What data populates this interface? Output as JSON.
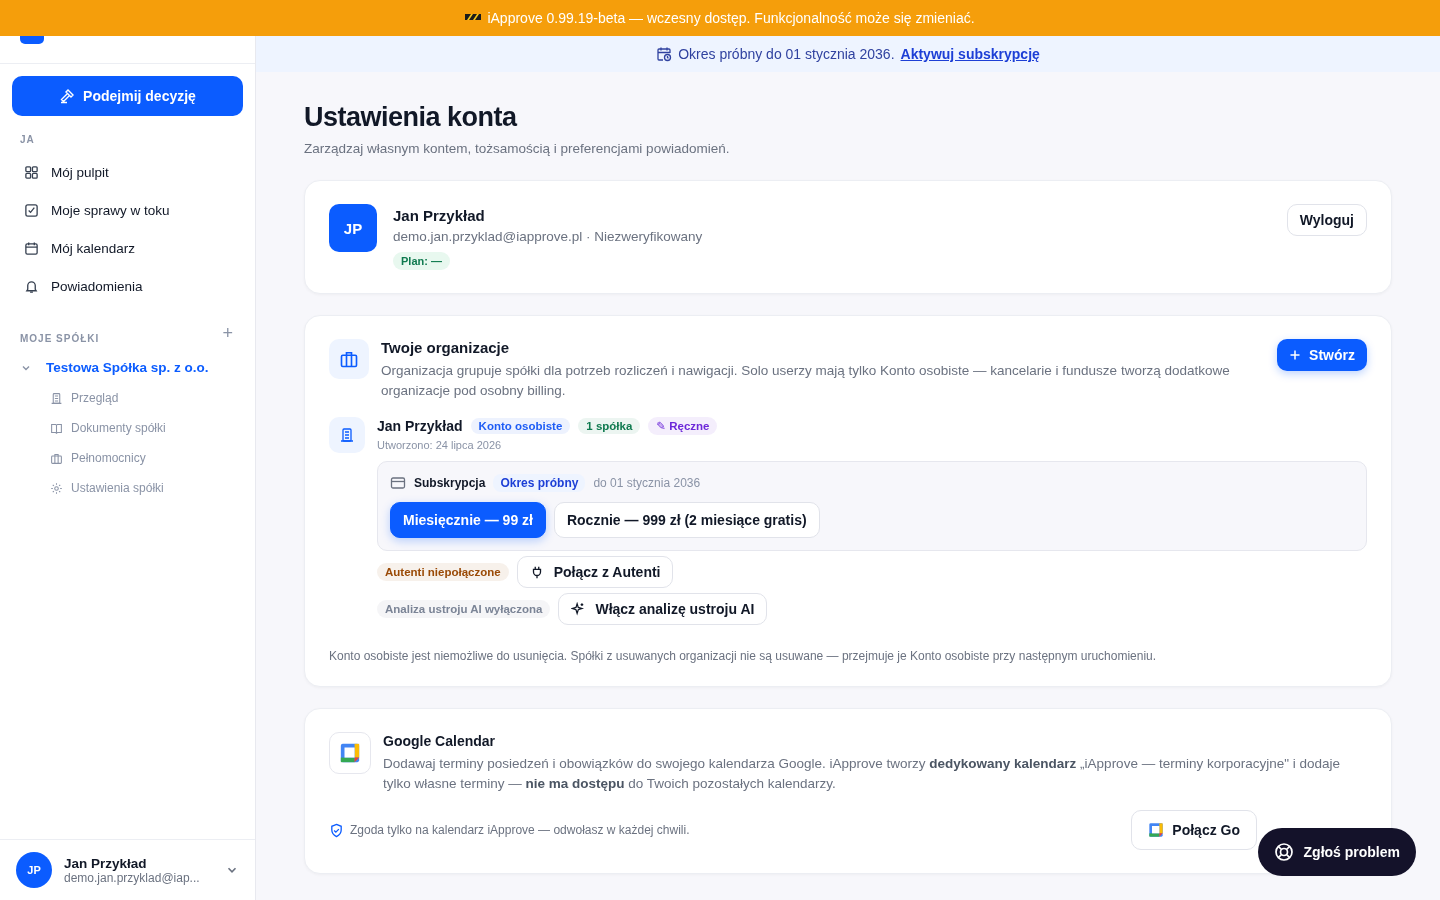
{
  "banner": {
    "text": "iApprove 0.99.19-beta — wczesny dostęp. Funkcjonalność może się zmieniać."
  },
  "sidebar": {
    "primary_button": "Podejmij decyzję",
    "section_me": "JA",
    "items": [
      {
        "label": "Mój pulpit"
      },
      {
        "label": "Moje sprawy w toku"
      },
      {
        "label": "Mój kalendarz"
      },
      {
        "label": "Powiadomienia"
      }
    ],
    "section_companies": "MOJE SPÓŁKI",
    "add_symbol": "+",
    "companies": [
      {
        "name": "Testowa Spółka sp. z o.o.",
        "expanded": true,
        "children": [
          {
            "label": "Przegląd"
          },
          {
            "label": "Dokumenty spółki"
          },
          {
            "label": "Pełnomocnicy"
          },
          {
            "label": "Ustawienia spółki"
          }
        ]
      }
    ],
    "user": {
      "initials": "JP",
      "name": "Jan Przykład",
      "email": "demo.jan.przyklad@iap..."
    }
  },
  "trial_bar": {
    "text": "Okres próbny do 01 stycznia 2036.",
    "link": "Aktywuj subskrypcję"
  },
  "page": {
    "title": "Ustawienia konta",
    "subtitle": "Zarządzaj własnym kontem, tożsamością i preferencjami powiadomień."
  },
  "profile": {
    "initials": "JP",
    "name": "Jan Przykład",
    "details": "demo.jan.przyklad@iapprove.pl · Niezweryfikowany",
    "plan": "Plan: —",
    "logout": "Wyloguj"
  },
  "organizations": {
    "title": "Twoje organizacje",
    "description": "Organizacja grupuje spółki dla potrzeb rozliczeń i nawigacji. Solo userzy mają tylko Konto osobiste — kancelarie i fundusze tworzą dodatkowe organizacje pod osobny billing.",
    "create": "Stwórz",
    "org": {
      "name": "Jan Przykład",
      "tags": [
        {
          "label": "Konto osobiste",
          "color": "#1d5cf5"
        },
        {
          "label": "1 spółka",
          "color": "#0f7a4f"
        },
        {
          "label": "✎ Ręczne",
          "color": "#6d28d9"
        }
      ],
      "created": "Utworzono: 24 lipca 2026",
      "subscription": {
        "label": "Subskrypcja",
        "status": "Okres próbny",
        "until": "do 01 stycznia 2036",
        "plans": [
          {
            "label": "Miesięcznie — 99 zł",
            "selected": true
          },
          {
            "label": "Rocznie — 999 zł (2 miesiące gratis)",
            "selected": false
          }
        ]
      },
      "integrations": [
        {
          "status": "Autenti niepołączone",
          "color": "#9a4a06",
          "action": "Połącz z Autenti"
        },
        {
          "status": "Analiza ustroju AI wyłączona",
          "color": "#7b8496",
          "action": "Włącz analizę ustroju AI"
        }
      ]
    },
    "note": "Konto osobiste jest niemożliwe do usunięcia. Spółki z usuwanych organizacji nie są usuwane — przejmuje je Konto osobiste przy następnym uruchomieniu."
  },
  "google": {
    "title": "Google Calendar",
    "description": "Dodawaj terminy posiedzeń i obowiązków do swojego kalendarza Google. iApprove tworzy **dedykowany kalendarz** „iApprove — terminy korporacyjne\" i dodaje tylko własne terminy — **nie ma dostępu** do Twoich pozostałych kalendarzy.",
    "consent": "Zgoda tylko na kalendarz iApprove — odwołasz w każdej chwili.",
    "connect": "Połącz Go"
  },
  "report_button": "Zgłoś problem"
}
